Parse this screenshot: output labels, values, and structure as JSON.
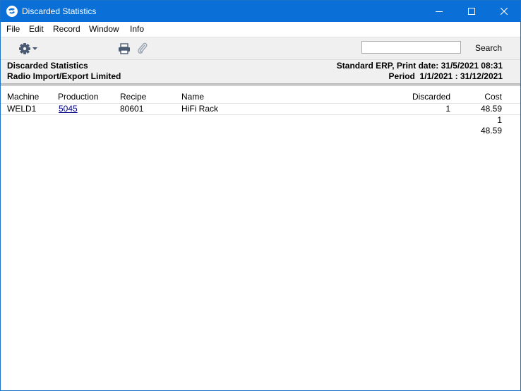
{
  "window": {
    "title": "Discarded Statistics"
  },
  "menu": [
    "File",
    "Edit",
    "Record",
    "Window",
    "Info"
  ],
  "toolbar": {
    "search_value": "",
    "search_label": "Search"
  },
  "report": {
    "title": "Discarded Statistics",
    "company": "Radio Import/Export Limited",
    "system_line": "Standard ERP, Print date: 31/5/2021 08:31",
    "period_line": "Period  1/1/2021 : 31/12/2021"
  },
  "table": {
    "columns": [
      "Machine",
      "Production",
      "Recipe",
      "Name",
      "Discarded",
      "Cost"
    ],
    "rows": [
      {
        "machine": "WELD1",
        "production": "5045",
        "recipe": "80601",
        "name": "HiFi Rack",
        "discarded": "1",
        "cost": "48.59"
      }
    ],
    "totals": {
      "discarded": "1",
      "cost": "48.59"
    }
  }
}
